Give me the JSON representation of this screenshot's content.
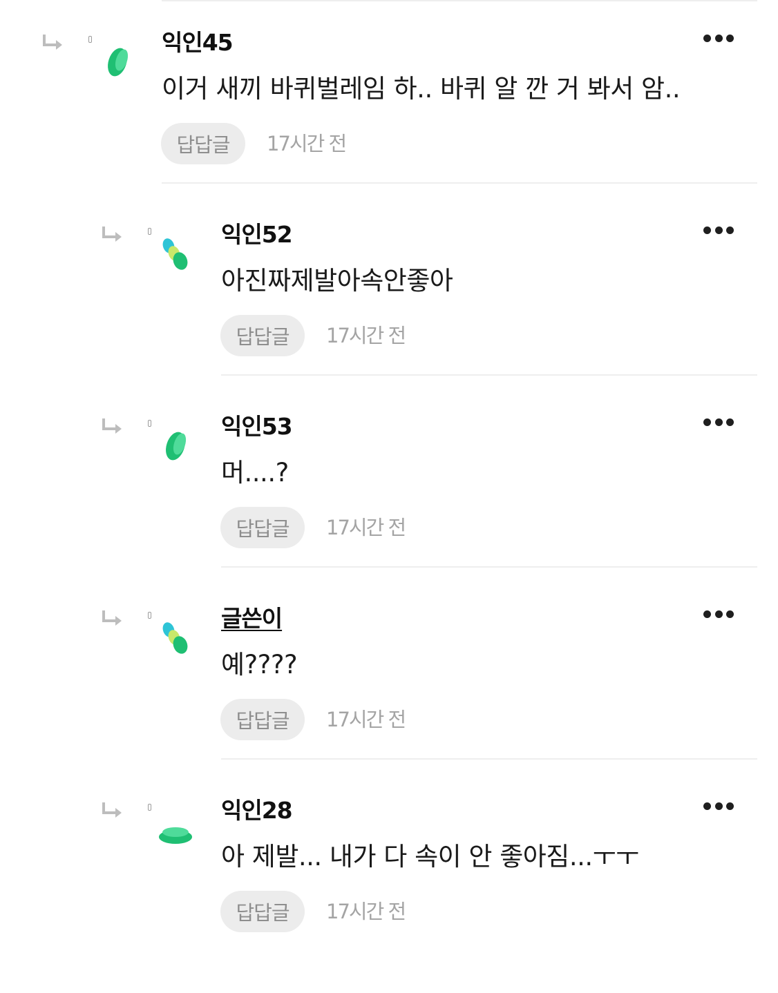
{
  "reply_button_label": "답답글",
  "comments": [
    {
      "nickname": "익인45",
      "text": "이거 새끼 바퀴벌레임 하.. 바퀴 알 깐 거 봐서 암..",
      "time": "17시간 전",
      "is_author": false,
      "avatar": "green-bean-avatar"
    },
    {
      "nickname": "익인52",
      "text": "아진짜제발아속안좋아",
      "time": "17시간 전",
      "is_author": false,
      "avatar": "multicolor-bean-avatar"
    },
    {
      "nickname": "익인53",
      "text": "머....?",
      "time": "17시간 전",
      "is_author": false,
      "avatar": "green-bean-avatar"
    },
    {
      "nickname": "글쓴이",
      "text": "예????",
      "time": "17시간 전",
      "is_author": true,
      "avatar": "multicolor-bean-avatar"
    },
    {
      "nickname": "익인28",
      "text": "아 제발... 내가 다 속이 안 좋아짐...ㅜㅜ",
      "time": "17시간 전",
      "is_author": false,
      "avatar": "flat-disc-avatar"
    }
  ],
  "colors": {
    "avatar_green_dark": "#1fbf73",
    "avatar_green_light": "#4fdb9a",
    "avatar_teal": "#2ec4d6",
    "avatar_lime": "#c9e86a",
    "reply_button_bg": "#ececec",
    "divider": "#eeeeee"
  }
}
